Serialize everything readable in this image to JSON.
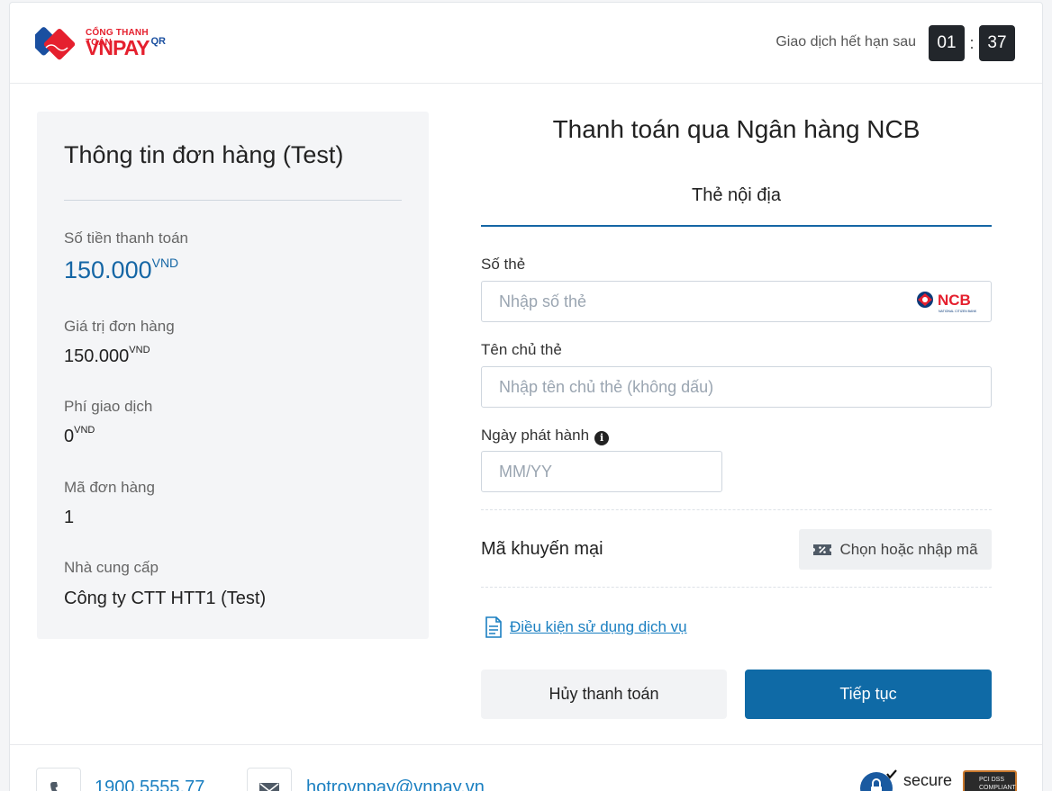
{
  "header": {
    "logo_top": "CỔNG THANH TOÁN",
    "logo_main": "VNPAY",
    "logo_qr": "QR",
    "timer_label": "Giao dịch hết hạn sau",
    "timer_minutes": "01",
    "timer_sep": ":",
    "timer_seconds": "37"
  },
  "order": {
    "title": "Thông tin đơn hàng (Test)",
    "amount_label": "Số tiền thanh toán",
    "amount_value": "150.000",
    "amount_currency": "VND",
    "order_value_label": "Giá trị đơn hàng",
    "order_value": "150.000",
    "order_value_currency": "VND",
    "fee_label": "Phí giao dịch",
    "fee_value": "0",
    "fee_currency": "VND",
    "order_id_label": "Mã đơn hàng",
    "order_id": "1",
    "provider_label": "Nhà cung cấp",
    "provider": "Công ty CTT HTT1 (Test)"
  },
  "form": {
    "title": "Thanh toán qua Ngân hàng NCB",
    "tab": "Thẻ nội địa",
    "card_number_label": "Số thẻ",
    "card_number_placeholder": "Nhập số thẻ",
    "bank_logo_text": "NCB",
    "bank_logo_sub": "NATIONAL CITIZEN BANK",
    "holder_label": "Tên chủ thẻ",
    "holder_placeholder": "Nhập tên chủ thẻ (không dấu)",
    "issue_date_label": "Ngày phát hành",
    "issue_date_placeholder": "MM/YY",
    "promo_label": "Mã khuyến mại",
    "promo_button": "Chọn hoặc nhập mã",
    "terms_link": "Điều kiện sử dụng dịch vụ",
    "cancel_button": "Hủy thanh toán",
    "continue_button": "Tiếp tục"
  },
  "footer": {
    "phone": "1900.5555.77",
    "email": "hotrovnpay@vnpay.vn",
    "secure_text": "secure",
    "pci_text": "PCI DSS COMPLIANT"
  },
  "colors": {
    "accent": "#1566a5",
    "link": "#1a7fc1",
    "brand_red": "#e5202e"
  }
}
